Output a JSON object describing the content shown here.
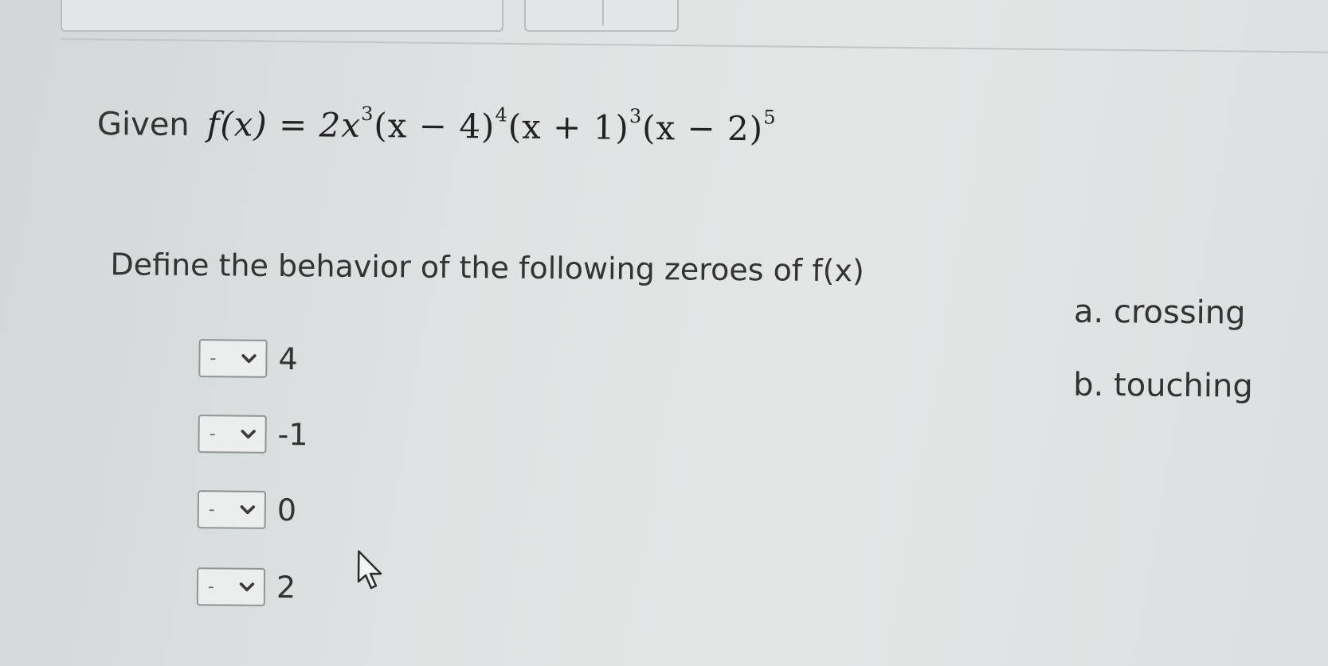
{
  "question": {
    "given_label": "Given",
    "formula_parts": {
      "lhs": "f(x) = 2x",
      "e1": "3",
      "p1": "(x − 4)",
      "e2": "4",
      "p2": "(x + 1)",
      "e3": "3",
      "p3": "(x − 2)",
      "e4": "5"
    },
    "instruction": "Define the behavior of the following zeroes of f(x)"
  },
  "options": [
    {
      "label": "a. crossing"
    },
    {
      "label": "b. touching"
    }
  ],
  "zeroes": [
    {
      "selected": "-",
      "label": "4"
    },
    {
      "selected": "-",
      "label": "-1"
    },
    {
      "selected": "-",
      "label": "0"
    },
    {
      "selected": "-",
      "label": "2"
    }
  ],
  "icons": {
    "select_arrow": "chevron-down-icon",
    "pointer": "mouse-cursor-icon"
  },
  "colors": {
    "background": "#dcdfe0",
    "text": "#333333",
    "select_border": "#8f9496"
  }
}
